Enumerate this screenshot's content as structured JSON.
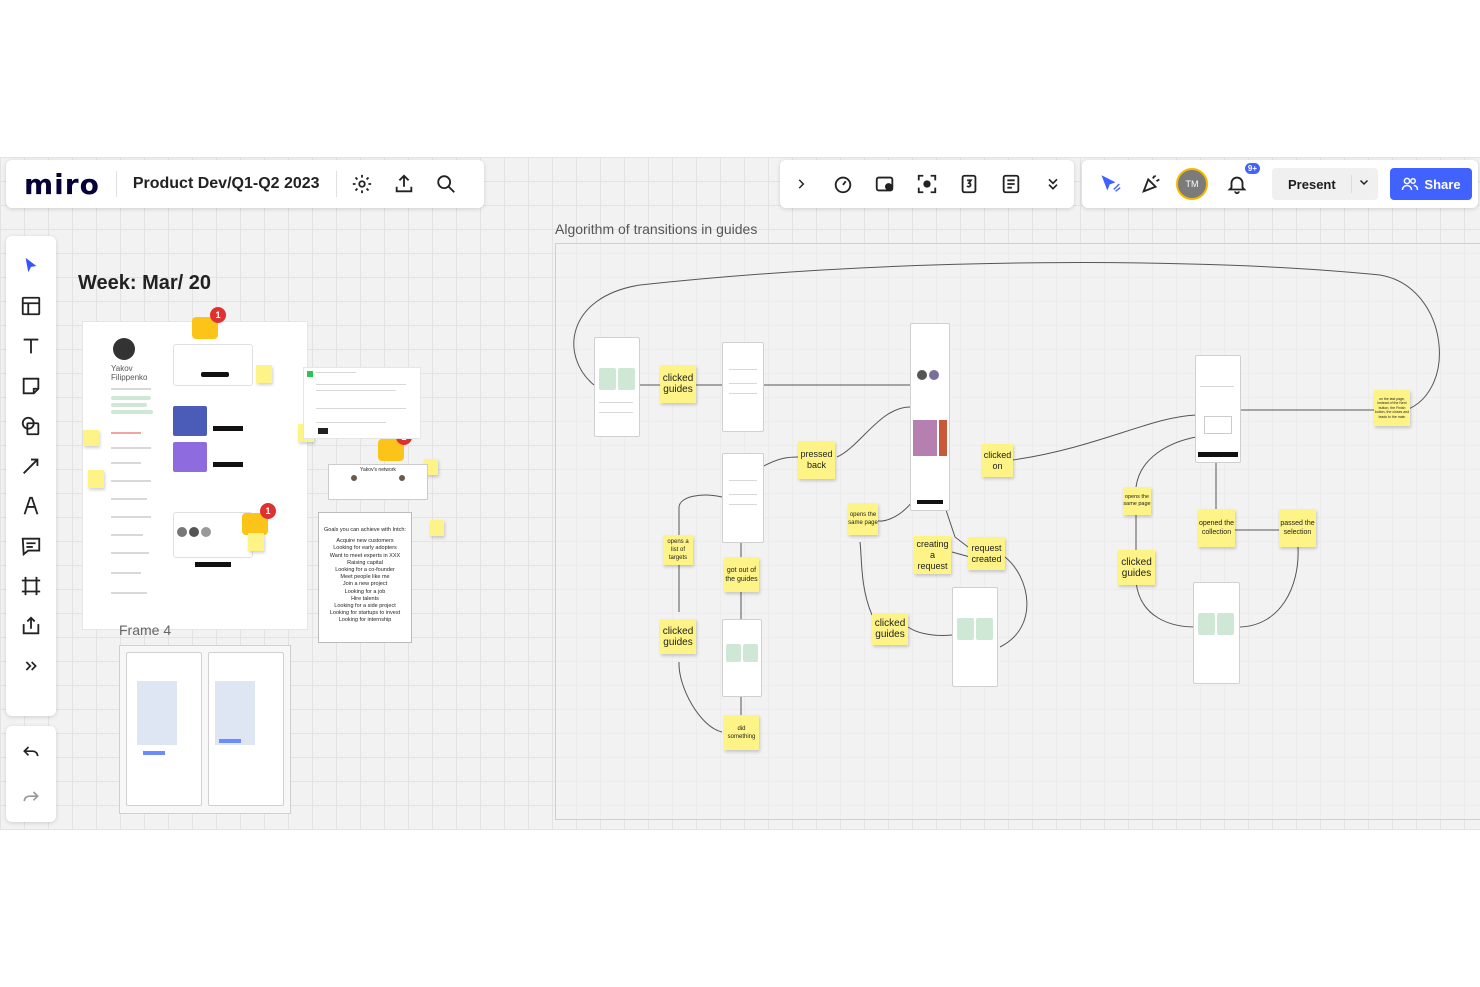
{
  "app": {
    "logo": "miro",
    "board_title": "Product Dev/Q1-Q2 2023"
  },
  "top_toolbar": {
    "icons": [
      "settings-icon",
      "export-icon",
      "search-icon"
    ]
  },
  "collab_toolbar": {
    "icons": [
      "chevron-right-icon",
      "timer-icon",
      "video-icon",
      "focus-icon",
      "count-icon",
      "notes-icon",
      "more-icon"
    ]
  },
  "right_toolbar": {
    "avatar_initials": "TM",
    "notification_badge": "9+",
    "present_label": "Present",
    "share_label": "Share",
    "accent_color": "#4262ff"
  },
  "left_toolbar": {
    "tools": [
      "select",
      "templates",
      "text",
      "sticky-note",
      "shapes",
      "connection-line",
      "pen",
      "comment",
      "frame",
      "upload",
      "more"
    ],
    "undo": "undo",
    "redo": "redo"
  },
  "board": {
    "week_label": "Week: Mar/ 20",
    "frame4_label": "Frame 4",
    "algorithm_title": "Algorithm of transitions in guides",
    "profile": {
      "first_name": "Yakov",
      "last_name": "Filippenko",
      "network_title": "Yakov's network",
      "comment_badges": [
        "1",
        "1",
        "2",
        "1"
      ]
    },
    "goals": {
      "title": "Goals you can achieve with Intch:",
      "items": [
        "Acquire new customers",
        "Looking for early adopters",
        "Want to meet experts in XXX",
        "Raising capital",
        "Looking for a co-founder",
        "Meet people like me",
        "Join a new project",
        "Looking for a job",
        "Hire talents",
        "Looking for a side project",
        "Looking for startups to invest",
        "Looking for internship"
      ]
    },
    "stickies": {
      "clicked_guides_1": "clicked guides",
      "pressed_back": "pressed back",
      "clicked_on": "clicked on",
      "opens_same_page_1": "opens the same page",
      "creating_request": "creating a request",
      "request_created": "request created",
      "clicked_guides_2": "clicked guides",
      "opens_list_targets": "opens a list of targets",
      "got_out_guides": "got out of the guides",
      "clicked_guides_3": "clicked guides",
      "did_something": "did something",
      "opens_same_page_2": "opens the same page",
      "clicked_guides_4": "clicked guides",
      "opened_collection": "opened the collection",
      "passed_selection": "passed the selection",
      "last_page_note": "on the last page, instead of the Next button, the Finish button, the closes and leads to the main"
    }
  }
}
